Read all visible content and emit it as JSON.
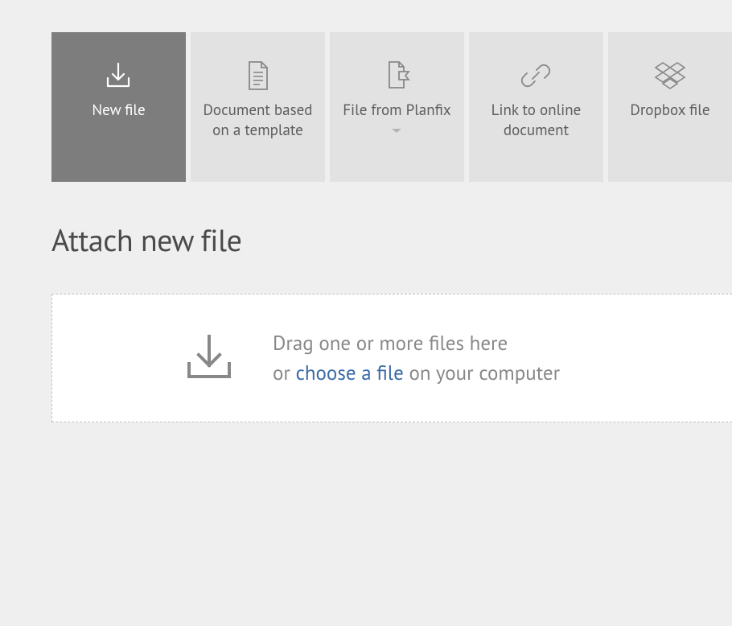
{
  "tabs": {
    "new_file": "New file",
    "doc_template": "Document based on a template",
    "file_from_planfix": "File from Planfix",
    "link_online": "Link to online document",
    "dropbox": "Dropbox file"
  },
  "heading": "Attach new file",
  "dropzone": {
    "line1": "Drag one or more files here",
    "line2_before": "or ",
    "line2_link": "choose a file",
    "line2_after": " on your computer"
  }
}
